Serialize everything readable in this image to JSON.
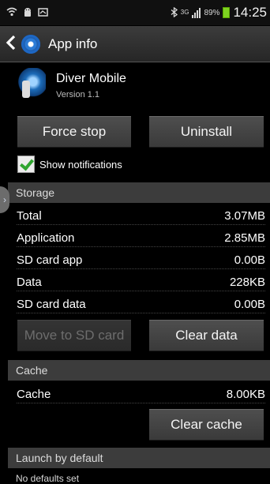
{
  "status_bar": {
    "icons": [
      "wifi-icon",
      "android-debug-icon",
      "screenshot-icon"
    ],
    "right_icons": [
      "bluetooth-icon",
      "3g-icon",
      "signal-icon",
      "battery-icon"
    ],
    "network": "3G",
    "battery_percent": "89%",
    "time": "14:25"
  },
  "titlebar": {
    "title": "App info"
  },
  "app": {
    "name": "Diver Mobile",
    "version": "Version 1.1"
  },
  "buttons": {
    "force_stop": "Force stop",
    "uninstall": "Uninstall",
    "move_to_sd": "Move to SD card",
    "clear_data": "Clear data",
    "clear_cache": "Clear cache"
  },
  "notifications": {
    "label": "Show notifications",
    "checked": true
  },
  "sections": {
    "storage": "Storage",
    "cache": "Cache",
    "launch": "Launch by default"
  },
  "storage_rows": [
    {
      "label": "Total",
      "value": "3.07MB"
    },
    {
      "label": "Application",
      "value": "2.85MB"
    },
    {
      "label": "SD card app",
      "value": "0.00B"
    },
    {
      "label": "Data",
      "value": "228KB"
    },
    {
      "label": "SD card data",
      "value": "0.00B"
    }
  ],
  "cache_row": {
    "label": "Cache",
    "value": "8.00KB"
  },
  "launch_text": "No defaults set",
  "colors": {
    "accent_check": "#2fa42f",
    "battery": "#7ed321",
    "section_bg": "#3c3c3c"
  }
}
